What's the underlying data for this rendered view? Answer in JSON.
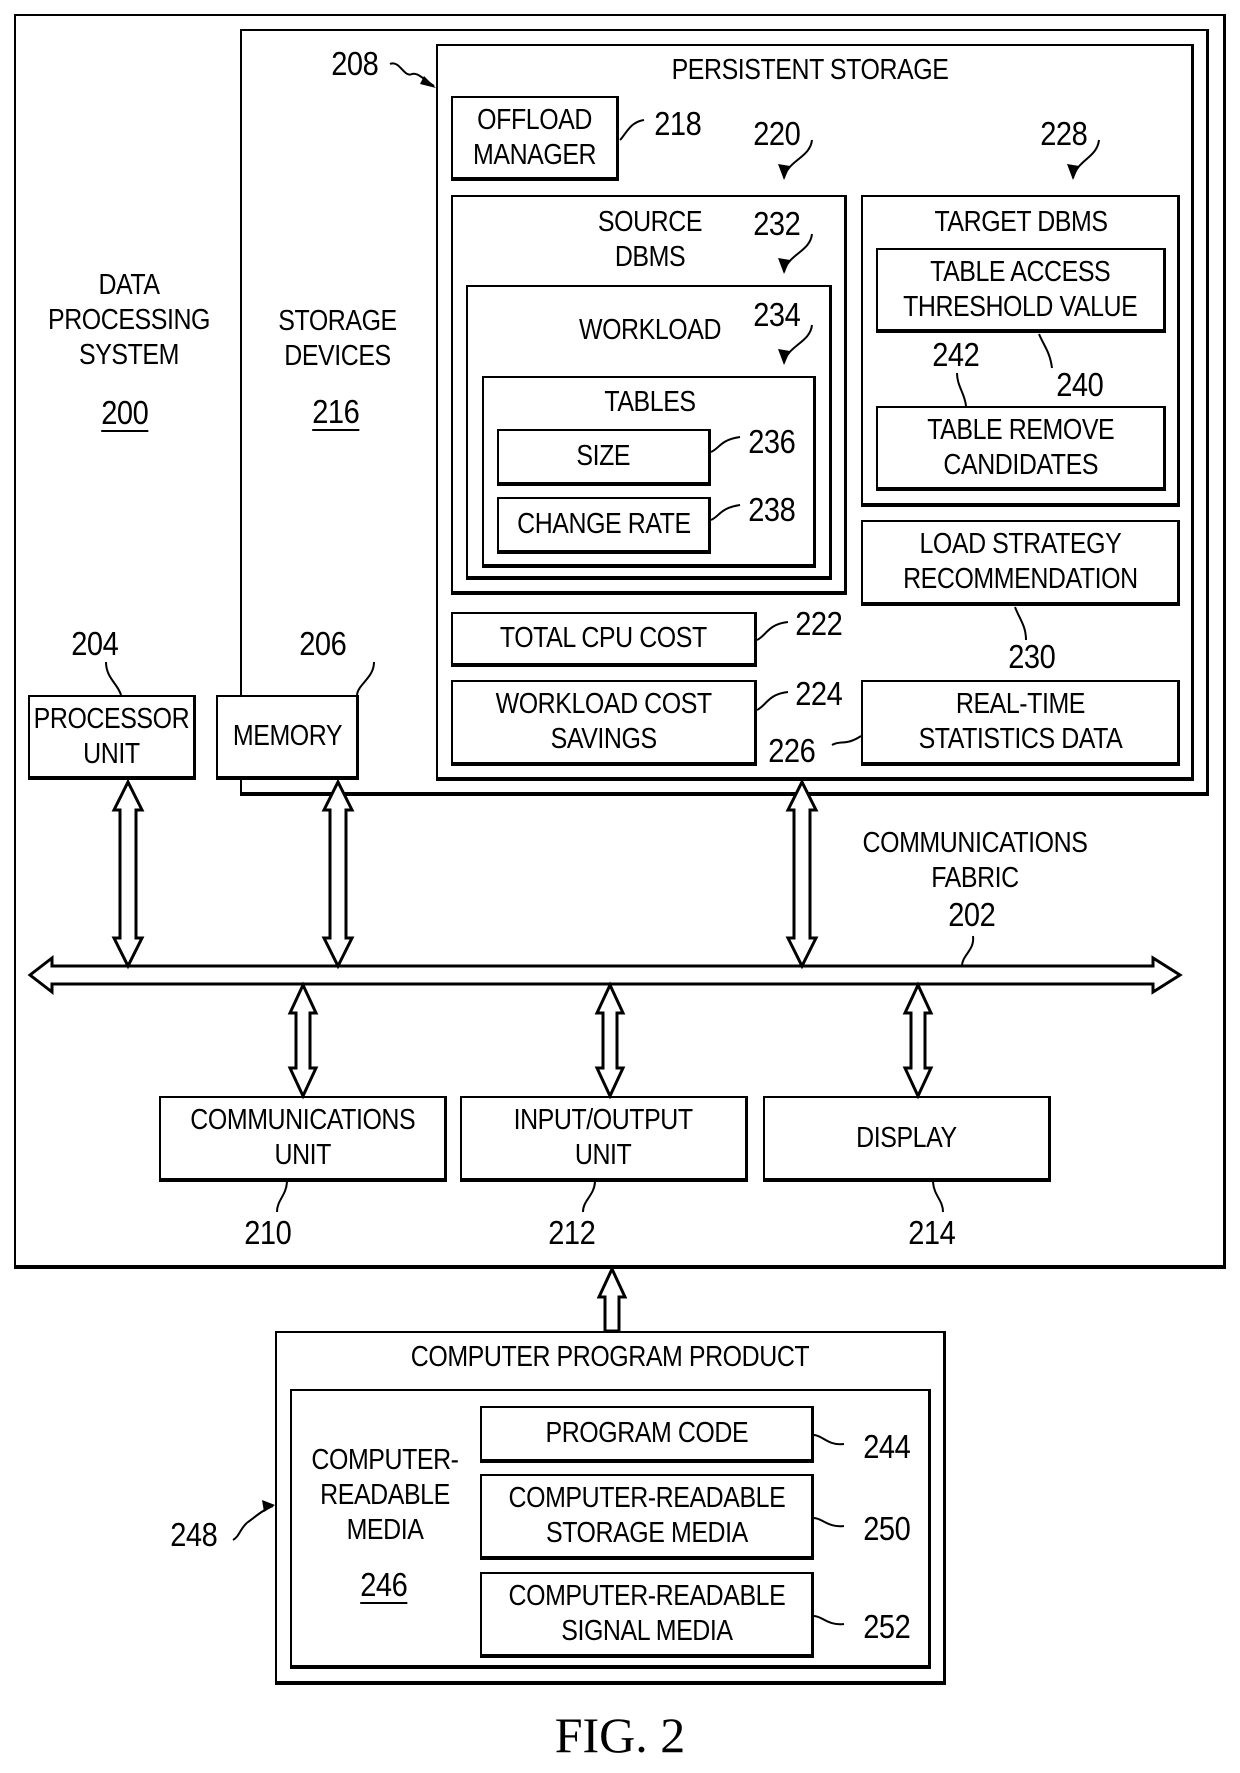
{
  "figure": {
    "caption": "FIG. 2"
  },
  "data_processing_system": {
    "label": "DATA\nPROCESSING\nSYSTEM",
    "ref": "200"
  },
  "storage_devices": {
    "label": "STORAGE\nDEVICES",
    "ref": "216"
  },
  "persistent_storage": {
    "label": "PERSISTENT STORAGE",
    "ref": "208"
  },
  "offload_manager": {
    "label": "OFFLOAD\nMANAGER",
    "ref": "218"
  },
  "source_dbms": {
    "label": "SOURCE\nDBMS",
    "ref": "220"
  },
  "workload": {
    "label": "WORKLOAD",
    "ref": "232"
  },
  "tables": {
    "label": "TABLES",
    "ref": "234"
  },
  "size": {
    "label": "SIZE",
    "ref": "236"
  },
  "change_rate": {
    "label": "CHANGE RATE",
    "ref": "238"
  },
  "target_dbms": {
    "label": "TARGET DBMS",
    "ref": "228"
  },
  "table_access_threshold": {
    "label": "TABLE ACCESS\nTHRESHOLD VALUE",
    "ref": "240"
  },
  "table_remove_candidates": {
    "label": "TABLE REMOVE\nCANDIDATES",
    "ref": "242"
  },
  "load_strategy": {
    "label": "LOAD STRATEGY\nRECOMMENDATION",
    "ref": "230"
  },
  "total_cpu_cost": {
    "label": "TOTAL CPU COST",
    "ref": "222"
  },
  "workload_cost_savings": {
    "label": "WORKLOAD COST\nSAVINGS",
    "ref": "224"
  },
  "realtime_stats": {
    "label": "REAL-TIME\nSTATISTICS DATA",
    "ref": "226"
  },
  "processor_unit": {
    "label": "PROCESSOR\nUNIT",
    "ref": "204"
  },
  "memory": {
    "label": "MEMORY",
    "ref": "206"
  },
  "communications_fabric": {
    "label": "COMMUNICATIONS\nFABRIC",
    "ref": "202"
  },
  "communications_unit": {
    "label": "COMMUNICATIONS\nUNIT",
    "ref": "210"
  },
  "io_unit": {
    "label": "INPUT/OUTPUT\nUNIT",
    "ref": "212"
  },
  "display": {
    "label": "DISPLAY",
    "ref": "214"
  },
  "computer_program_product": {
    "label": "COMPUTER PROGRAM PRODUCT",
    "ref": "248"
  },
  "computer_readable_media": {
    "label": "COMPUTER-\nREADABLE\nMEDIA",
    "ref": "246"
  },
  "program_code": {
    "label": "PROGRAM CODE",
    "ref": "244"
  },
  "cr_storage_media": {
    "label": "COMPUTER-READABLE\nSTORAGE MEDIA",
    "ref": "250"
  },
  "cr_signal_media": {
    "label": "COMPUTER-READABLE\nSIGNAL MEDIA",
    "ref": "252"
  }
}
